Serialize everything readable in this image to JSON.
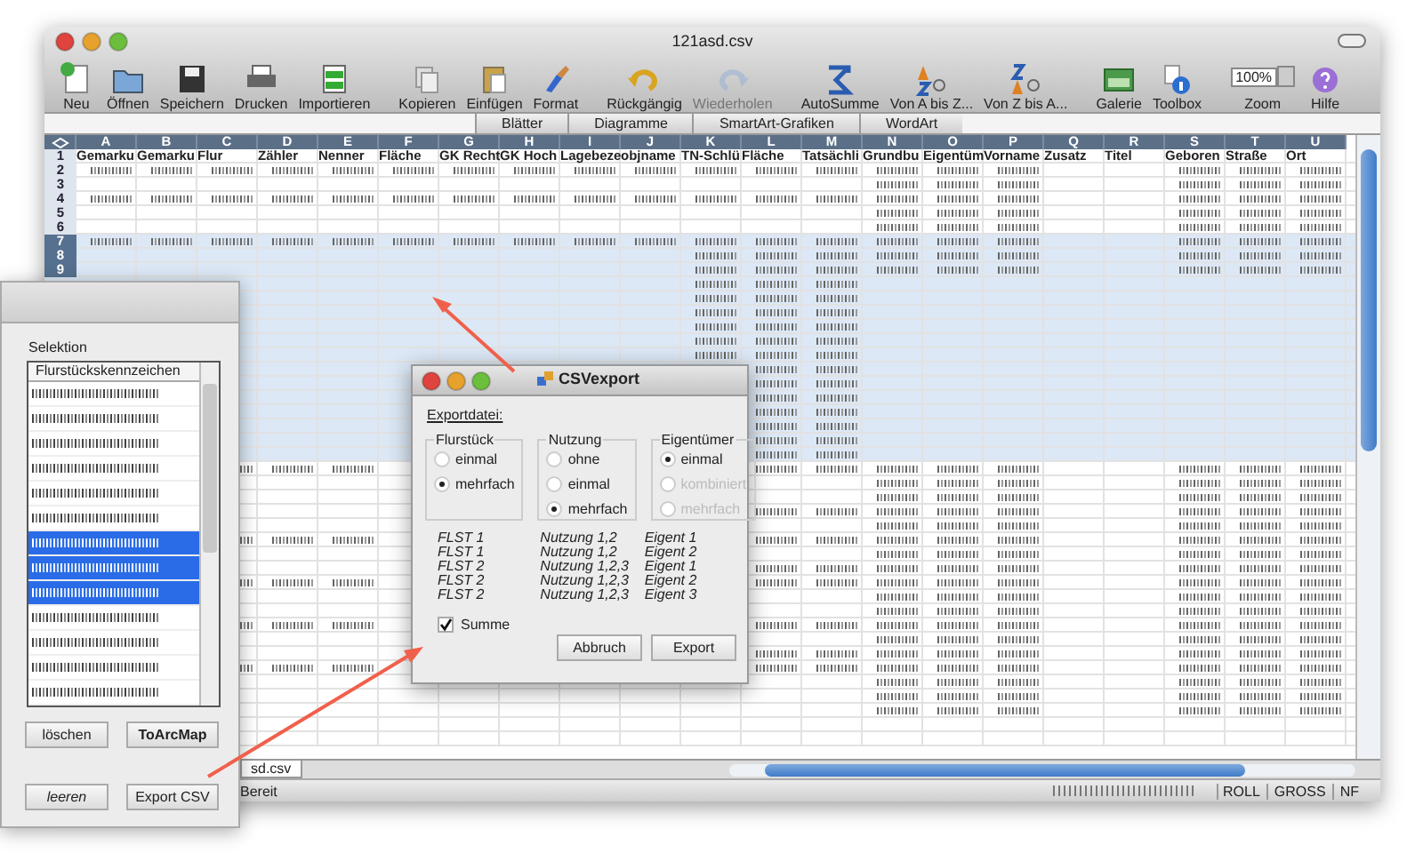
{
  "window": {
    "title": "121asd.csv"
  },
  "toolbar": [
    {
      "label": "Neu",
      "kind": "new",
      "disabled": false
    },
    {
      "label": "Öffnen",
      "kind": "open",
      "disabled": false
    },
    {
      "label": "Speichern",
      "kind": "save",
      "disabled": false
    },
    {
      "label": "Drucken",
      "kind": "print",
      "disabled": false
    },
    {
      "label": "Importieren",
      "kind": "import",
      "disabled": false
    },
    {
      "label": "Kopieren",
      "kind": "copy",
      "disabled": false
    },
    {
      "label": "Einfügen",
      "kind": "paste",
      "disabled": false
    },
    {
      "label": "Format",
      "kind": "brush",
      "disabled": false
    },
    {
      "label": "Rückgängig",
      "kind": "undo",
      "disabled": false
    },
    {
      "label": "Wiederholen",
      "kind": "redo",
      "disabled": true
    },
    {
      "label": "AutoSumme",
      "kind": "sum",
      "disabled": false
    },
    {
      "label": "Von A bis Z...",
      "kind": "sortaz",
      "disabled": false
    },
    {
      "label": "Von Z bis A...",
      "kind": "sortza",
      "disabled": false
    },
    {
      "label": "Galerie",
      "kind": "gallery",
      "disabled": false
    },
    {
      "label": "Toolbox",
      "kind": "info",
      "disabled": false
    },
    {
      "label": "Zoom",
      "kind": "zoom",
      "value": "100%"
    },
    {
      "label": "Hilfe",
      "kind": "help",
      "disabled": false
    }
  ],
  "ribbon_tabs": [
    "Blätter",
    "Diagramme",
    "SmartArt-Grafiken",
    "WordArt"
  ],
  "sheet": {
    "columns": [
      "A",
      "B",
      "C",
      "D",
      "E",
      "F",
      "G",
      "H",
      "I",
      "J",
      "K",
      "L",
      "M",
      "N",
      "O",
      "P",
      "Q",
      "R",
      "S",
      "T",
      "U"
    ],
    "headers": [
      "Gemarku",
      "Gemarku",
      "Flur",
      "Zähler",
      "Nenner",
      "Fläche",
      "GK Recht",
      "GK Hoch",
      "Lagebeze",
      "objname",
      "TN-Schlü",
      "Fläche",
      "Tatsächli",
      "Grundbu",
      "Eigentüm",
      "Vorname",
      "Zusatz",
      "Titel",
      "Geboren",
      "Straße",
      "Ort"
    ],
    "rows": [
      {
        "number": "1",
        "selected": false,
        "kind": "header"
      },
      {
        "number": "2",
        "selected": false,
        "kind": "full"
      },
      {
        "number": "3",
        "selected": false,
        "kind": "owner"
      },
      {
        "number": "4",
        "selected": false,
        "kind": "full"
      },
      {
        "number": "5",
        "selected": false,
        "kind": "owner"
      },
      {
        "number": "6",
        "selected": false,
        "kind": "owner"
      },
      {
        "number": "7",
        "selected": true,
        "kind": "full"
      },
      {
        "number": "8",
        "selected": true,
        "kind": "parcel-owner"
      },
      {
        "number": "9",
        "selected": true,
        "kind": "parcel-owner"
      },
      {
        "selected": true,
        "kind": "parcel"
      },
      {
        "selected": true,
        "kind": "parcel"
      },
      {
        "selected": true,
        "kind": "parcel"
      },
      {
        "selected": true,
        "kind": "parcel"
      },
      {
        "selected": true,
        "kind": "parcel"
      },
      {
        "selected": true,
        "kind": "parcel"
      },
      {
        "selected": true,
        "kind": "parcel"
      },
      {
        "selected": true,
        "kind": "parcel"
      },
      {
        "selected": true,
        "kind": "parcel"
      },
      {
        "selected": true,
        "kind": "parcel"
      },
      {
        "selected": true,
        "kind": "parcel"
      },
      {
        "selected": true,
        "kind": "parcel"
      },
      {
        "selected": true,
        "kind": "parcel"
      },
      {
        "selected": false,
        "kind": "mixed"
      },
      {
        "selected": false,
        "kind": "owner"
      },
      {
        "selected": false,
        "kind": "owner"
      },
      {
        "selected": false,
        "kind": "parcel-owner"
      },
      {
        "selected": false,
        "kind": "owner"
      },
      {
        "selected": false,
        "kind": "mixed"
      },
      {
        "selected": false,
        "kind": "owner"
      },
      {
        "selected": false,
        "kind": "parcel-owner"
      },
      {
        "selected": false,
        "kind": "mixed"
      },
      {
        "selected": false,
        "kind": "owner"
      },
      {
        "selected": false,
        "kind": "owner"
      },
      {
        "selected": false,
        "kind": "mixed"
      },
      {
        "selected": false,
        "kind": "owner"
      },
      {
        "selected": false,
        "kind": "parcel-owner"
      },
      {
        "selected": false,
        "kind": "mixed"
      },
      {
        "selected": false,
        "kind": "owner"
      },
      {
        "selected": false,
        "kind": "owner"
      },
      {
        "selected": false,
        "kind": "owner"
      },
      {
        "selected": false,
        "kind": "empty"
      },
      {
        "selected": false,
        "kind": "empty"
      }
    ]
  },
  "sheet_tab": "sd.csv",
  "status_bar": {
    "text": "Bereit",
    "indicators": [
      "ROLL",
      "GROSS",
      "NF"
    ]
  },
  "selection_panel": {
    "group": "Selektion",
    "list_header": "Flurstückskennzeichen",
    "items": [
      {
        "selected": false
      },
      {
        "selected": false
      },
      {
        "selected": false
      },
      {
        "selected": false
      },
      {
        "selected": false
      },
      {
        "selected": false
      },
      {
        "selected": true
      },
      {
        "selected": true
      },
      {
        "selected": true
      },
      {
        "selected": false
      },
      {
        "selected": false
      },
      {
        "selected": false
      },
      {
        "selected": false
      }
    ],
    "buttons": [
      {
        "label": "löschen",
        "kind": "plain"
      },
      {
        "label": "ToArcMap",
        "kind": "bold"
      },
      {
        "label": "leeren",
        "kind": "italic"
      },
      {
        "label": "Export CSV",
        "kind": "plain"
      }
    ]
  },
  "dialog": {
    "title": "CSVexport",
    "section": "Exportdatei:",
    "groups": [
      {
        "title": "Flurstück",
        "options": [
          {
            "label": "einmal",
            "selected": false
          },
          {
            "label": "mehrfach",
            "selected": true
          }
        ],
        "examples": [
          "FLST 1",
          "FLST 1",
          "FLST 2",
          "FLST 2",
          "FLST 2"
        ]
      },
      {
        "title": "Nutzung",
        "options": [
          {
            "label": "ohne",
            "selected": false
          },
          {
            "label": "einmal",
            "selected": false
          },
          {
            "label": "mehrfach",
            "selected": true
          }
        ],
        "examples": [
          "Nutzung 1,2",
          "Nutzung 1,2",
          "Nutzung 1,2,3",
          "Nutzung 1,2,3",
          "Nutzung 1,2,3"
        ]
      },
      {
        "title": "Eigentümer",
        "options": [
          {
            "label": "einmal",
            "selected": true,
            "disabled": false
          },
          {
            "label": "kombiniert",
            "selected": false,
            "disabled": true
          },
          {
            "label": "mehrfach",
            "selected": false,
            "disabled": true
          }
        ],
        "examples": [
          "Eigent 1",
          "Eigent 2",
          "Eigent 1",
          "Eigent 2",
          "Eigent 3"
        ]
      }
    ],
    "summe": {
      "label": "Summe",
      "checked": true
    },
    "buttons": [
      "Abbruch",
      "Export"
    ]
  }
}
